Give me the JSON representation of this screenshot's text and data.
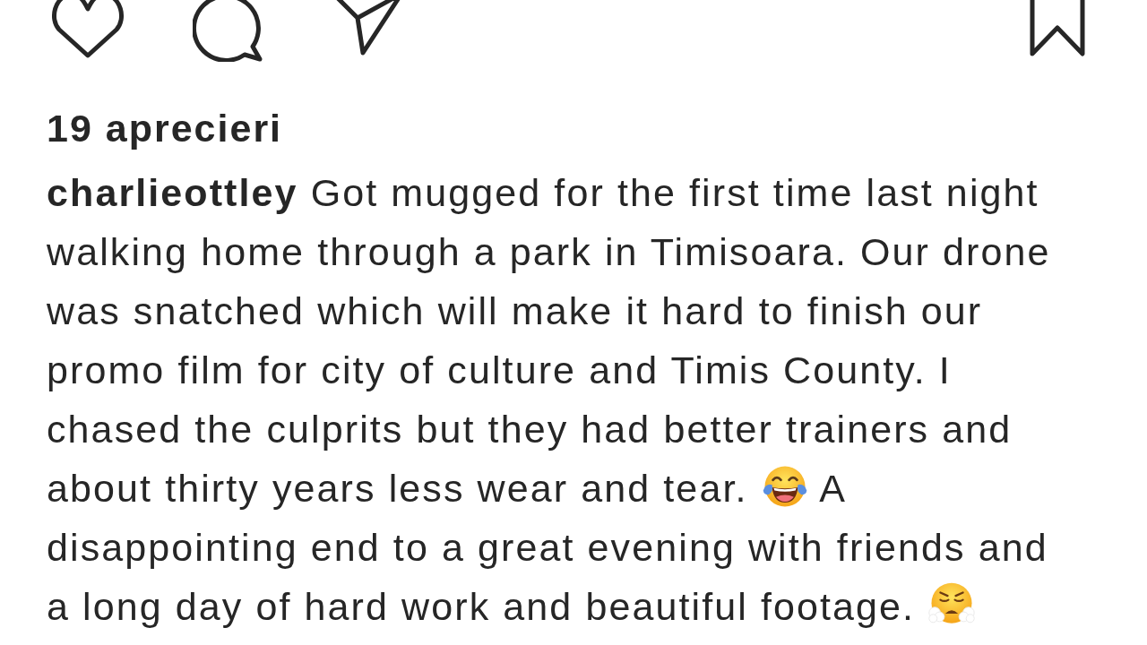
{
  "likes": "19 aprecieri",
  "caption": {
    "username": "charlieottley",
    "segments": [
      {
        "kind": "text",
        "text": "Got mugged for the first time last night walking home through a park in Timisoara. Our drone was snatched which will make it hard to finish our promo film for city of culture and Timis County. I chased the culprits but they had better trainers and about thirty years less wear and tear."
      },
      {
        "kind": "laughing"
      },
      {
        "kind": "text",
        "text": "A disappointing end to a great evening with friends and a long day of hard work and beautiful footage."
      },
      {
        "kind": "huffing"
      }
    ]
  }
}
